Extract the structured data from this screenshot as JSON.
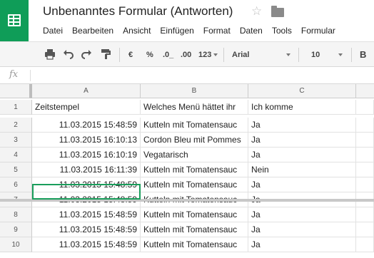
{
  "app": {
    "title": "Unbenanntes Formular (Antworten)",
    "accent_color": "#0f9d58",
    "icons": [
      "sheets-logo-icon",
      "star-icon",
      "folder-icon"
    ]
  },
  "menu": [
    "Datei",
    "Bearbeiten",
    "Ansicht",
    "Einfügen",
    "Format",
    "Daten",
    "Tools",
    "Formular"
  ],
  "toolbar": {
    "currency": "€",
    "percent": "%",
    "decrease_decimals": ".0_",
    "increase_decimals": ".00",
    "more_formats": "123",
    "font": "Arial",
    "font_size": "10",
    "bold": "B"
  },
  "formula_bar": {
    "fx_label": "fx",
    "value": ""
  },
  "sheet": {
    "columns": [
      "A",
      "B",
      "C"
    ],
    "row_numbers": [
      "1",
      "2",
      "3",
      "4",
      "5",
      "6",
      "7",
      "8",
      "9",
      "10"
    ],
    "header_row": [
      "Zeitstempel",
      "Welches Menü hättet ihr",
      "Ich komme"
    ],
    "rows": [
      [
        "11.03.2015 15:48:59",
        "Kutteln mit Tomatensauc",
        "Ja"
      ],
      [
        "11.03.2015 16:10:13",
        "Cordon Bleu mit Pommes",
        "Ja"
      ],
      [
        "11.03.2015 16:10:19",
        "Vegatarisch",
        "Ja"
      ],
      [
        "11.03.2015 16:11:39",
        "Kutteln mit Tomatensauc",
        "Nein"
      ],
      [
        "11.03.2015 15:48:59",
        "Kutteln mit Tomatensauc",
        "Ja"
      ],
      [
        "11.03.2015 15:48:59",
        "Kutteln mit Tomatensauc",
        "Ja"
      ],
      [
        "11.03.2015 15:48:59",
        "Kutteln mit Tomatensauc",
        "Ja"
      ],
      [
        "11.03.2015 15:48:59",
        "Kutteln mit Tomatensauc",
        "Ja"
      ],
      [
        "11.03.2015 15:48:59",
        "Kutteln mit Tomatensauc",
        "Ja"
      ]
    ]
  }
}
